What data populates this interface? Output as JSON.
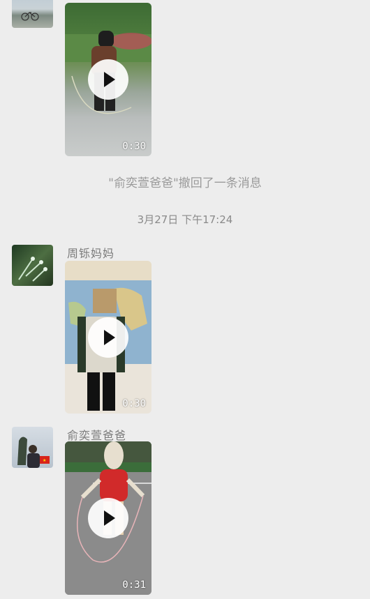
{
  "messages": [
    {
      "sender": "",
      "duration": "0:30"
    },
    {
      "sender": "周铄妈妈",
      "duration": "0:30"
    },
    {
      "sender": "俞奕萱爸爸",
      "duration": "0:31"
    }
  ],
  "system_notice": "\"俞奕萱爸爸\"撤回了一条消息",
  "timestamp": "3月27日 下午17:24",
  "colors": {
    "background": "#ededed",
    "system_text": "#9a9a9a",
    "sender_text": "#7a7a7a"
  },
  "icons": [
    "play-icon"
  ]
}
